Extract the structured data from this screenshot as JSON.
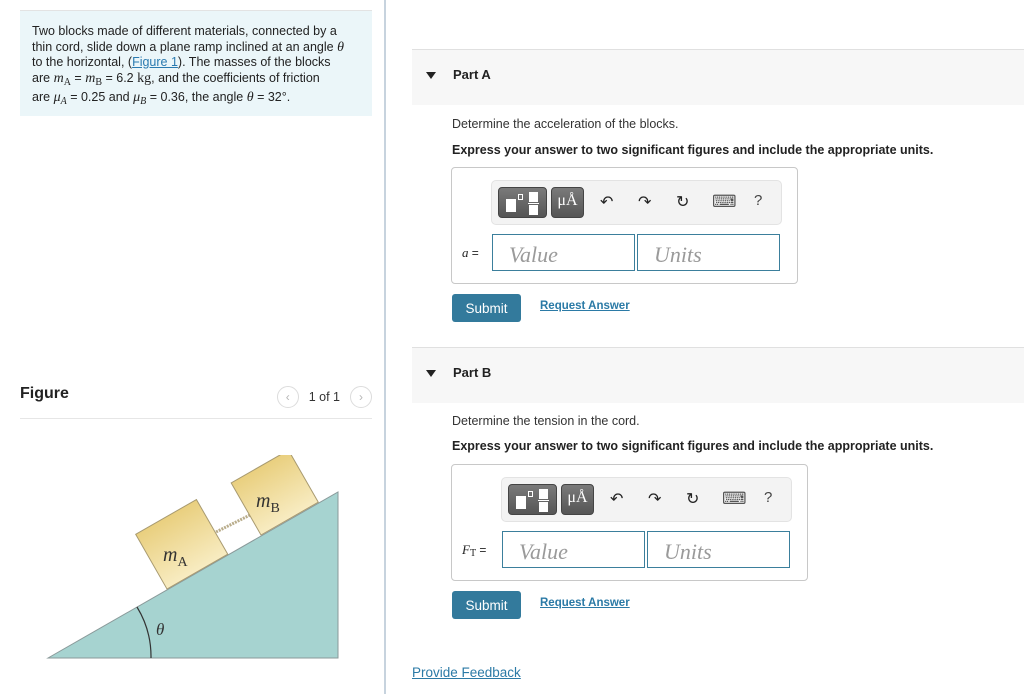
{
  "problem": {
    "text_line1": "Two blocks made of different materials, connected by a",
    "text_line2": "thin cord, slide down a plane ramp inclined at an angle",
    "theta_symbol": "θ",
    "text_line3_pre": "to the horizontal, (",
    "figure_link": "Figure 1",
    "text_line3_post": "). The masses of the blocks",
    "are": "are",
    "m": "m",
    "sub_A": "A",
    "sub_B": "B",
    "mass_value": "= 6.2",
    "mass_unit": "kg",
    "friction_text": ", and the coefficients of friction",
    "mu": "μ",
    "muA_value": "= 0.25 and",
    "muB_value": "= 0.36, the angle",
    "angle_value": "= 32°."
  },
  "figure": {
    "title": "Figure",
    "pager_text": "1 of 1",
    "prev_icon": "‹",
    "next_icon": "›",
    "label_mA": "m",
    "label_mA_sub": "A",
    "label_mB": "m",
    "label_mB_sub": "B",
    "label_theta": "θ",
    "colors": {
      "ramp": "#a6d3d0",
      "block": "#f0d98e",
      "cord": "#b9ad8c"
    }
  },
  "parts": [
    {
      "title": "Part A",
      "prompt": "Determine the acceleration of the blocks.",
      "instruction": "Express your answer to two significant figures and include the appropriate units.",
      "variable": "a",
      "variable_sub": "",
      "value_placeholder": "Value",
      "units_placeholder": "Units",
      "submit_label": "Submit",
      "request_label": "Request Answer"
    },
    {
      "title": "Part B",
      "prompt": "Determine the tension in the cord.",
      "instruction": "Express your answer to two significant figures and include the appropriate units.",
      "variable": "F",
      "variable_sub": "T",
      "value_placeholder": "Value",
      "units_placeholder": "Units",
      "submit_label": "Submit",
      "request_label": "Request Answer"
    }
  ],
  "toolbar": {
    "units_button": "μÅ",
    "undo_icon": "↶",
    "redo_icon": "↷",
    "reset_icon": "↻",
    "keyboard_icon": "⌨",
    "help_icon": "?"
  },
  "eq_sign": "=",
  "feedback_label": "Provide Feedback",
  "colors": {
    "accent": "#337a9c",
    "link": "#2b7aa6",
    "problem_bg": "#ebf6f9"
  }
}
